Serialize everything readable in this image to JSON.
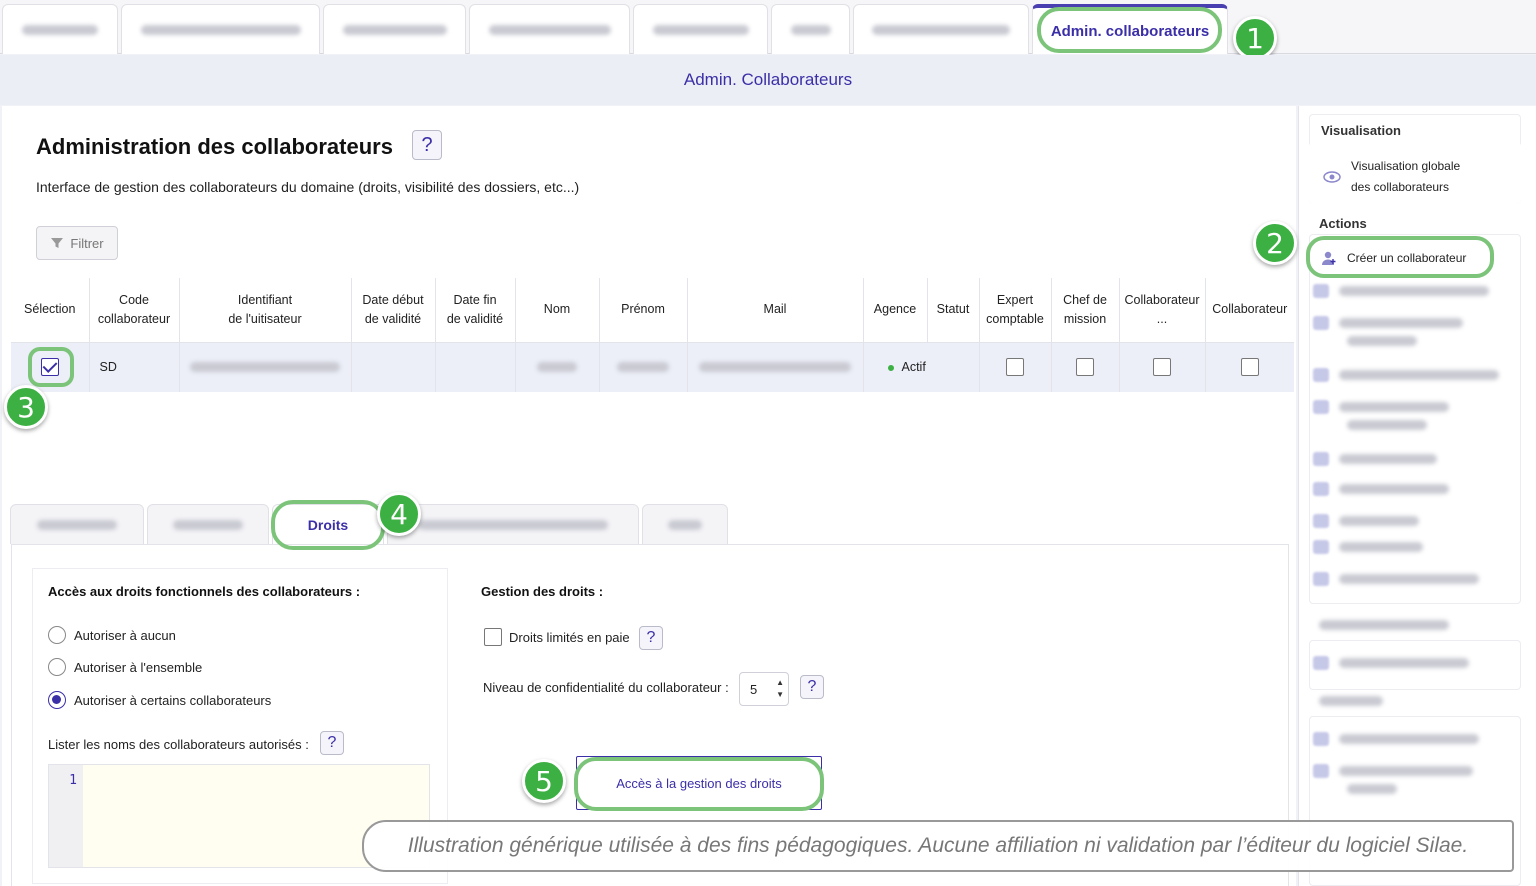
{
  "top_tabs": {
    "active_label": "Admin. collaborateurs"
  },
  "page_title_bar": "Admin. Collaborateurs",
  "main": {
    "title": "Administration des collaborateurs",
    "help": "?",
    "subtitle": "Interface de gestion des collaborateurs du domaine (droits, visibilité des dossiers, etc...)",
    "filter_label": "Filtrer"
  },
  "table": {
    "headers": [
      [
        "Sélection",
        ""
      ],
      [
        "Code",
        "collaborateur"
      ],
      [
        "Identifiant",
        "de l'uitisateur"
      ],
      [
        "Date début",
        "de validité"
      ],
      [
        "Date fin",
        "de validité"
      ],
      [
        "Nom",
        ""
      ],
      [
        "Prénom",
        ""
      ],
      [
        "Mail",
        ""
      ],
      [
        "Agence",
        ""
      ],
      [
        "Statut",
        ""
      ],
      [
        "Expert",
        "comptable"
      ],
      [
        "Chef de",
        "mission"
      ],
      [
        "Collaborateur",
        "..."
      ],
      [
        "Collaborateur",
        ""
      ]
    ],
    "row": {
      "code": "SD",
      "statut": "Actif"
    }
  },
  "lower_tabs": {
    "active_label": "Droits"
  },
  "rights": {
    "left_title": "Accès aux droits fonctionnels des collaborateurs :",
    "radio_none": "Autoriser à aucun",
    "radio_all": "Autoriser à l'ensemble",
    "radio_some": "Autoriser à certains collaborateurs",
    "list_label": "Lister les noms des collaborateurs autorisés :",
    "editor_line": "1",
    "right_title": "Gestion des droits :",
    "limited_label": "Droits limités en paie",
    "level_label": "Niveau de confidentialité du collaborateur :",
    "level_value": "5",
    "access_button": "Accès à la gestion des droits"
  },
  "sidebar": {
    "visualisation_head": "Visualisation",
    "visualisation_item_line1": "Visualisation globale",
    "visualisation_item_line2": "des collaborateurs",
    "actions_head": "Actions",
    "create_label": "Créer un collaborateur"
  },
  "badges": [
    "1",
    "2",
    "3",
    "4",
    "5"
  ],
  "disclaimer": "Illustration générique utilisée à des fins pédagogiques. Aucune affiliation ni validation par l’éditeur du logiciel Silae.",
  "colors": {
    "accent": "#3b2fa8",
    "highlight": "#7cc47a",
    "badge": "#3cb043"
  }
}
